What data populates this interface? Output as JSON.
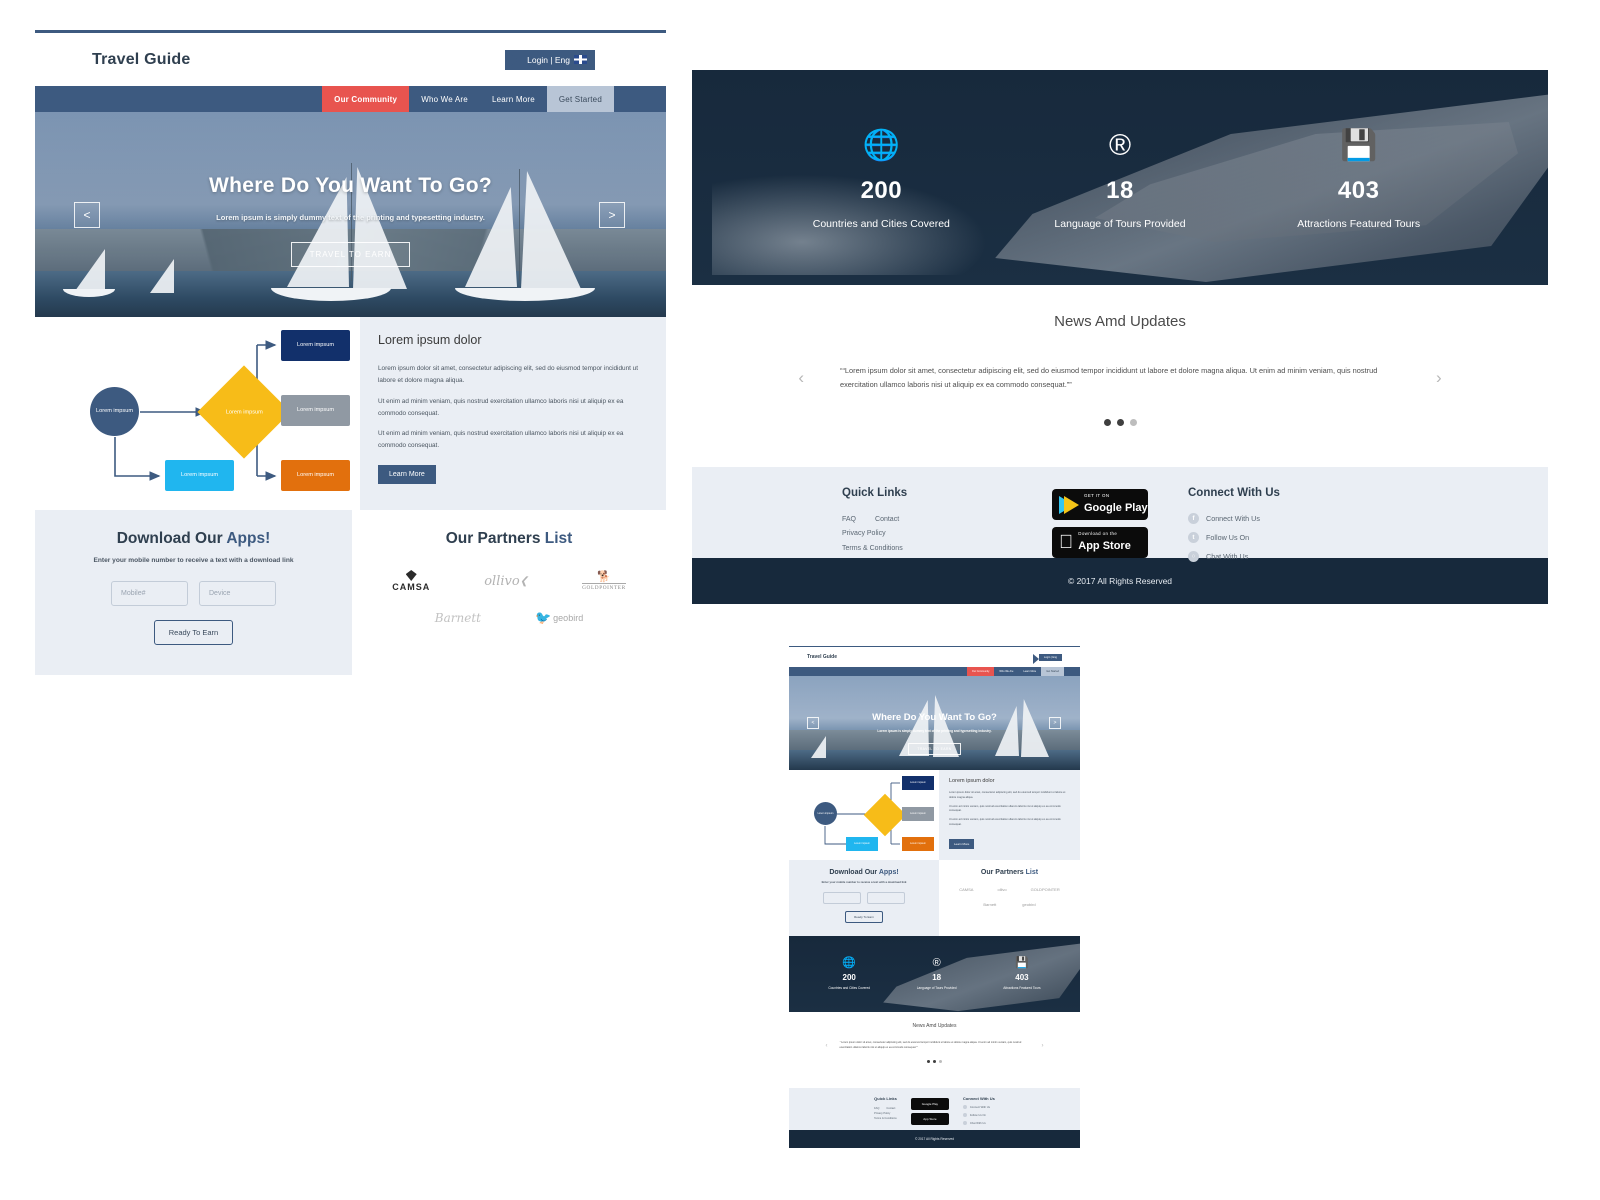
{
  "header": {
    "brand": "Travel Guide",
    "login_label": "Login  |  Eng",
    "flag_icon": "uk-flag-icon"
  },
  "nav": {
    "items": [
      {
        "label": "Our Community",
        "state": "active"
      },
      {
        "label": "Who We Are",
        "state": "default"
      },
      {
        "label": "Learn More",
        "state": "default"
      },
      {
        "label": "Get Started",
        "state": "cta"
      }
    ]
  },
  "hero": {
    "title": "Where Do You Want To Go?",
    "subtitle": "Lorem ipsum is simply dummy text of the printing and typesetting industry.",
    "cta": "TRAVEL TO EARN",
    "prev": "<",
    "next": ">"
  },
  "diagram": {
    "nodes": [
      {
        "id": "start",
        "shape": "circle",
        "label": "Lorem impsum",
        "color": "#3d5a80"
      },
      {
        "id": "decision",
        "shape": "diamond",
        "label": "Lorem impsum",
        "color": "#f7bc18"
      },
      {
        "id": "out-1",
        "shape": "rect",
        "label": "Lorem impsum",
        "color": "#12306b"
      },
      {
        "id": "out-2",
        "shape": "rect",
        "label": "Lorem impsum",
        "color": "#9099a3"
      },
      {
        "id": "out-3",
        "shape": "rect",
        "label": "Lorem impsum",
        "color": "#e2700d"
      },
      {
        "id": "branch",
        "shape": "rect",
        "label": "Lorem impsum",
        "color": "#20b6ef"
      }
    ]
  },
  "about": {
    "title": "Lorem ipsum dolor",
    "paragraphs": [
      "Lorem ipsum dolor sit amet, consectetur adipiscing elit, sed do eiusmod tempor incididunt ut labore et dolore magna aliqua.",
      "Ut enim ad minim veniam, quis nostrud exercitation ullamco laboris nisi ut aliquip ex ea commodo consequat.",
      "Ut enim ad minim veniam, quis nostrud exercitation ullamco laboris nisi ut aliquip ex ea commodo consequat."
    ],
    "button": "Learn More"
  },
  "apps": {
    "title_main": "Download Our ",
    "title_accent": "Apps!",
    "subtitle": "Enter your mobile number to receive a text with a download link",
    "mobile_placeholder": "Mobile#",
    "device_placeholder": "Device",
    "button": "Ready To Earn"
  },
  "partners": {
    "title_main": "Our Partners ",
    "title_accent": "List",
    "logos": [
      {
        "name": "CAMSA",
        "icon": "diamond-logo-icon"
      },
      {
        "name": "ollivo",
        "icon": "leaf-logo-icon"
      },
      {
        "name": "GOLDPOINTER",
        "icon": "dog-logo-icon"
      },
      {
        "name": "Barnett",
        "icon": "script-logo-icon"
      },
      {
        "name": "geobird",
        "icon": "bird-logo-icon"
      }
    ]
  },
  "stats": {
    "items": [
      {
        "icon": "globe-clock-icon",
        "glyph": "🌐",
        "value": "200",
        "label": "Countries and  Cities Covered"
      },
      {
        "icon": "registered-trademark-icon",
        "glyph": "®",
        "value": "18",
        "label": "Language of Tours  Provided"
      },
      {
        "icon": "save-download-icon",
        "glyph": "💾",
        "value": "403",
        "label": "Attractions Featured Tours"
      }
    ]
  },
  "news": {
    "title": "News Amd Updates",
    "prev": "‹",
    "next": "›",
    "quote": "““Lorem ipsum dolor sit amet, consectetur adipiscing elit, sed do eiusmod tempor incididunt ut labore et dolore magna aliqua. Ut enim ad minim veniam, quis nostrud exercitation ullamco laboris nisi ut aliquip ex ea commodo consequat.””",
    "dots": [
      true,
      true,
      false
    ]
  },
  "footer": {
    "quick_links_title": "Quick Links",
    "quick_links": [
      "FAQ",
      "Contact",
      "Privacy Policy",
      "Terms & Conditions"
    ],
    "stores": [
      {
        "small": "GET IT ON",
        "big": "Google Play",
        "icon": "google-play-icon"
      },
      {
        "small": "Download on the",
        "big": "App Store",
        "icon": "apple-icon"
      }
    ],
    "connect_title": "Connect With Us",
    "social": [
      {
        "label": "Connect With Us",
        "icon": "facebook-icon",
        "glyph": "f"
      },
      {
        "label": "Follow Us On",
        "icon": "twitter-icon",
        "glyph": "t"
      },
      {
        "label": "Chat With Us",
        "icon": "chat-icon",
        "glyph": "○"
      }
    ],
    "copyright": "© 2017  All Rights Reserved"
  },
  "colors": {
    "navy": "#3d5a80",
    "dark_navy": "#17293c",
    "accent_red": "#e8544f",
    "cta_gray": "#b8c5d6",
    "panel_gray": "#eaeef4",
    "yellow": "#f7bc18",
    "orange": "#e2700d",
    "cyan": "#20b6ef",
    "deep_navy": "#12306b",
    "gray_node": "#9099a3"
  }
}
